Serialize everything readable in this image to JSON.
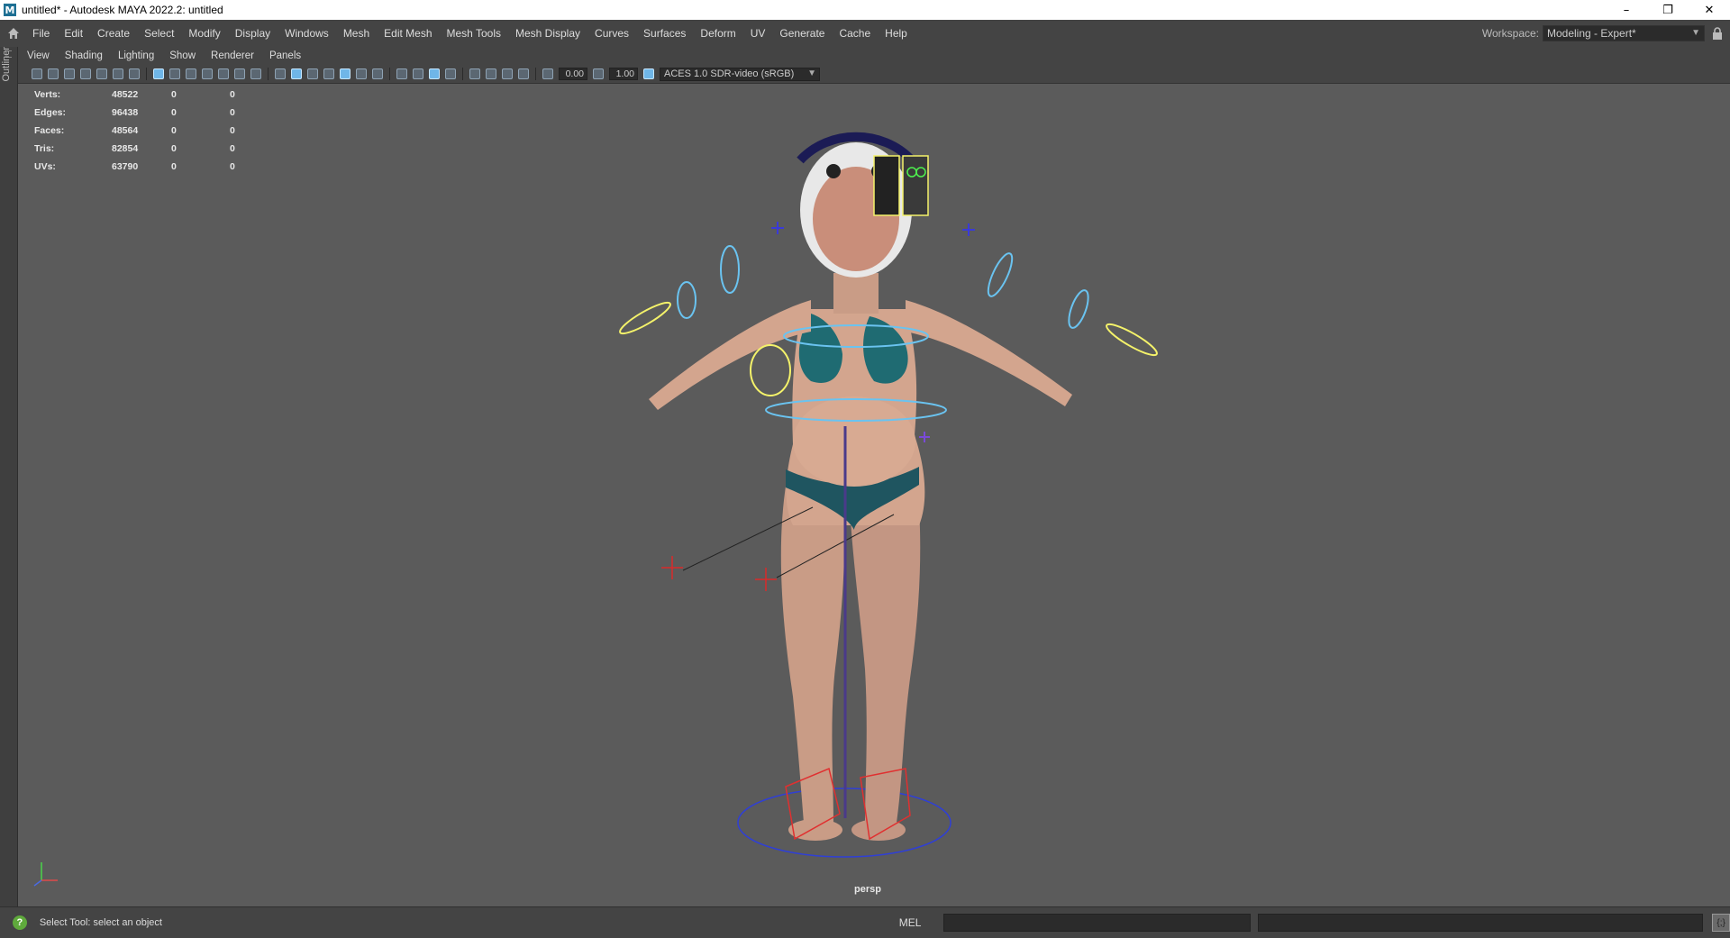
{
  "window": {
    "title": "untitled* - Autodesk MAYA 2022.2: untitled",
    "icon_letter": "M",
    "controls": [
      "–",
      "❐",
      "✕"
    ]
  },
  "menubar": {
    "items": [
      "File",
      "Edit",
      "Create",
      "Select",
      "Modify",
      "Display",
      "Windows",
      "Mesh",
      "Edit Mesh",
      "Mesh Tools",
      "Mesh Display",
      "Curves",
      "Surfaces",
      "Deform",
      "UV",
      "Generate",
      "Cache",
      "Help"
    ],
    "workspace_label": "Workspace:",
    "workspace_value": "Modeling - Expert*"
  },
  "outliner": {
    "tab_label": "Outliner"
  },
  "panel_menu": {
    "items": [
      "View",
      "Shading",
      "Lighting",
      "Show",
      "Renderer",
      "Panels"
    ]
  },
  "toolbar": {
    "exposure": "0.00",
    "gamma": "1.00",
    "color_management": "ACES 1.0 SDR-video (sRGB)"
  },
  "hud": {
    "rows": [
      {
        "label": "Verts:",
        "v1": "48522",
        "v2": "0",
        "v3": "0"
      },
      {
        "label": "Edges:",
        "v1": "96438",
        "v2": "0",
        "v3": "0"
      },
      {
        "label": "Faces:",
        "v1": "48564",
        "v2": "0",
        "v3": "0"
      },
      {
        "label": "Tris:",
        "v1": "82854",
        "v2": "0",
        "v3": "0"
      },
      {
        "label": "UVs:",
        "v1": "63790",
        "v2": "0",
        "v3": "0"
      }
    ]
  },
  "viewport": {
    "camera": "persp"
  },
  "status": {
    "help_text": "Select Tool: select an object",
    "command_language": "MEL"
  }
}
